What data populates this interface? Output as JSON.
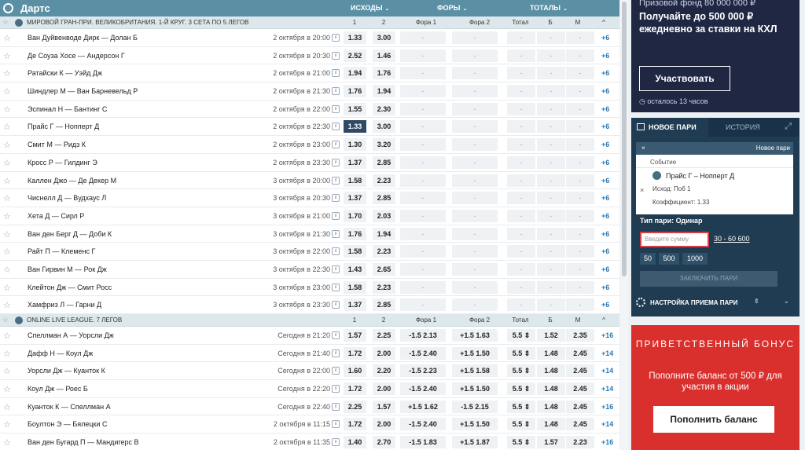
{
  "header": {
    "title": "Дартс",
    "cols": [
      "Исходы",
      "Форы",
      "Тоталы"
    ]
  },
  "sections": [
    {
      "name": "Мировой Гран-При. Великобритания. 1-й круг. 3 сета по 5 легов",
      "heads": [
        "1",
        "2",
        "Фора 1",
        "Фора 2",
        "Тотал",
        "Б",
        "М",
        "^"
      ],
      "rows": [
        {
          "match": "Ван Дуйвенводе Дирк — Долан Б",
          "date": "2 октября в 20:00",
          "o1": "1.33",
          "o2": "3.00",
          "more": "+6"
        },
        {
          "match": "Де Соуза Хосе — Андерсон Г",
          "date": "2 октября в 20:30",
          "o1": "2.52",
          "o2": "1.46",
          "more": "+6"
        },
        {
          "match": "Ратайски К — Уэйд Дж",
          "date": "2 октября в 21:00",
          "o1": "1.94",
          "o2": "1.76",
          "more": "+6"
        },
        {
          "match": "Шиндлер М — Ван Барневельд Р",
          "date": "2 октября в 21:30",
          "o1": "1.76",
          "o2": "1.94",
          "more": "+6"
        },
        {
          "match": "Эспинал Н — Бантинг С",
          "date": "2 октября в 22:00",
          "o1": "1.55",
          "o2": "2.30",
          "more": "+6"
        },
        {
          "match": "Прайс Г — Ноппert Д",
          "date": "2 октября в 22:30",
          "o1": "1.33",
          "o2": "3.00",
          "more": "+6",
          "sel": true
        },
        {
          "match": "Смит М — Ридз К",
          "date": "2 октября в 23:00",
          "o1": "1.30",
          "o2": "3.20",
          "more": "+6"
        },
        {
          "match": "Кросс Р — Гилдинг Э",
          "date": "2 октября в 23:30",
          "o1": "1.37",
          "o2": "2.85",
          "more": "+6"
        },
        {
          "match": "Каллен Джо — Де Декер М",
          "date": "3 октября в 20:00",
          "o1": "1.58",
          "o2": "2.23",
          "more": "+6"
        },
        {
          "match": "Чиснелл Д — Вудхаус Л",
          "date": "3 октября в 20:30",
          "o1": "1.37",
          "o2": "2.85",
          "more": "+6"
        },
        {
          "match": "Хета Д — Сирл Р",
          "date": "3 октября в 21:00",
          "o1": "1.70",
          "o2": "2.03",
          "more": "+6"
        },
        {
          "match": "Ван ден Берг Д — Доби К",
          "date": "3 октября в 21:30",
          "o1": "1.76",
          "o2": "1.94",
          "more": "+6"
        },
        {
          "match": "Райт П — Клеменс Г",
          "date": "3 октября в 22:00",
          "o1": "1.58",
          "o2": "2.23",
          "more": "+6"
        },
        {
          "match": "Ван Гирвин М — Рок Дж",
          "date": "3 октября в 22:30",
          "o1": "1.43",
          "o2": "2.65",
          "more": "+6"
        },
        {
          "match": "Клейтон Дж — Смит Росс",
          "date": "3 октября в 23:00",
          "o1": "1.58",
          "o2": "2.23",
          "more": "+6"
        },
        {
          "match": "Хамфриз Л — Гарни Д",
          "date": "3 октября в 23:30",
          "o1": "1.37",
          "o2": "2.85",
          "more": "+6"
        }
      ]
    },
    {
      "name": "Online Live League. 7 легов",
      "heads": [
        "1",
        "2",
        "Фора 1",
        "Фора 2",
        "Тотал",
        "Б",
        "М",
        "^"
      ],
      "rows": [
        {
          "match": "Спеллман А — Уорсли Дж",
          "date": "Сегодня в 21:20",
          "o1": "1.57",
          "o2": "2.25",
          "f1h": "-1.5",
          "f1": "2.13",
          "f2h": "+1.5",
          "f2": "1.63",
          "t": "5.5",
          "b": "1.52",
          "m": "2.35",
          "more": "+16"
        },
        {
          "match": "Дафф Н — Коул Дж",
          "date": "Сегодня в 21:40",
          "o1": "1.72",
          "o2": "2.00",
          "f1h": "-1.5",
          "f1": "2.40",
          "f2h": "+1.5",
          "f2": "1.50",
          "t": "5.5",
          "b": "1.48",
          "m": "2.45",
          "more": "+14"
        },
        {
          "match": "Уорсли Дж — Куанток К",
          "date": "Сегодня в 22:00",
          "o1": "1.60",
          "o2": "2.20",
          "f1h": "-1.5",
          "f1": "2.23",
          "f2h": "+1.5",
          "f2": "1.58",
          "t": "5.5",
          "b": "1.48",
          "m": "2.45",
          "more": "+14"
        },
        {
          "match": "Коул Дж — Роес Б",
          "date": "Сегодня в 22:20",
          "o1": "1.72",
          "o2": "2.00",
          "f1h": "-1.5",
          "f1": "2.40",
          "f2h": "+1.5",
          "f2": "1.50",
          "t": "5.5",
          "b": "1.48",
          "m": "2.45",
          "more": "+14"
        },
        {
          "match": "Куанток К — Спеллман А",
          "date": "Сегодня в 22:40",
          "o1": "2.25",
          "o2": "1.57",
          "f1h": "+1.5",
          "f1": "1.62",
          "f2h": "-1.5",
          "f2": "2.15",
          "t": "5.5",
          "b": "1.48",
          "m": "2.45",
          "more": "+16"
        },
        {
          "match": "Боултон Э — Бялецки С",
          "date": "2 октября в 11:15",
          "o1": "1.72",
          "o2": "2.00",
          "f1h": "-1.5",
          "f1": "2.40",
          "f2h": "+1.5",
          "f2": "1.50",
          "t": "5.5",
          "b": "1.48",
          "m": "2.45",
          "more": "+14"
        },
        {
          "match": "Ван ден Бугард П — Мандигерс В",
          "date": "2 октября в 11:35",
          "o1": "1.40",
          "o2": "2.70",
          "f1h": "-1.5",
          "f1": "1.83",
          "f2h": "+1.5",
          "f2": "1.87",
          "t": "5.5",
          "b": "1.57",
          "m": "2.23",
          "more": "+16"
        }
      ]
    }
  ],
  "promo": {
    "fund": "Призовой фонд 80 000 000 ₽",
    "big": "Получайте до 500 000 ₽ ежедневно за ставки на КХЛ",
    "btn": "Участвовать",
    "remain": "осталось 13 часов"
  },
  "slip": {
    "tab_new": "Новое пари",
    "tab_hist": "История",
    "bar_new": "Новое пари",
    "event_label": "Событие",
    "event": "Прайс Г – Ноппert Д",
    "outcome": "Исход: Поб 1",
    "coef": "Коэффициент:  1.33",
    "type": "Тип пари: Одинар",
    "sum_placeholder": "Введите сумму",
    "range": "30 - 60 600",
    "quick": [
      "50",
      "500",
      "1000"
    ],
    "place": "ЗАКЛЮЧИТЬ ПАРИ",
    "settings": "НАСТРОЙКА ПРИЕМА ПАРИ"
  },
  "bonus": {
    "title": "ПРИВЕТСТВЕННЫЙ БОНУС",
    "sub": "Пополните баланс от 500 ₽ для участия в акции",
    "btn": "Пополнить баланс"
  }
}
